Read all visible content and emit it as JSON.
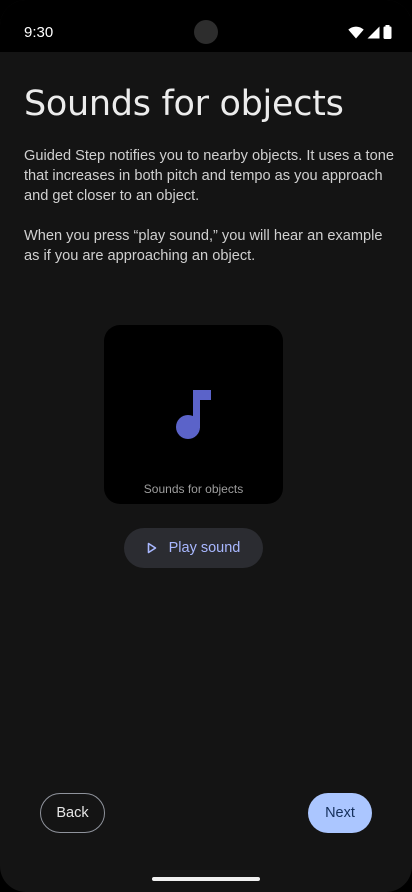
{
  "status_bar": {
    "time": "9:30",
    "icons": [
      "wifi-icon",
      "signal-icon",
      "battery-icon"
    ]
  },
  "page": {
    "title": "Sounds for objects",
    "paragraph_1": "Guided Step notifies you to nearby objects. It uses a tone that increases in both pitch and tempo as you approach and get closer to an object.",
    "paragraph_2": "When you press “play sound,” you will hear an example as if you are approaching an object."
  },
  "media_card": {
    "icon": "music-note-icon",
    "caption": "Sounds for objects"
  },
  "play_button": {
    "icon": "play-icon",
    "label": "Play sound"
  },
  "navigation": {
    "back_label": "Back",
    "next_label": "Next"
  },
  "colors": {
    "background": "#141414",
    "accent": "#a9b8ff",
    "note_icon": "#5b63c9",
    "next_button": "#abc6ff"
  }
}
